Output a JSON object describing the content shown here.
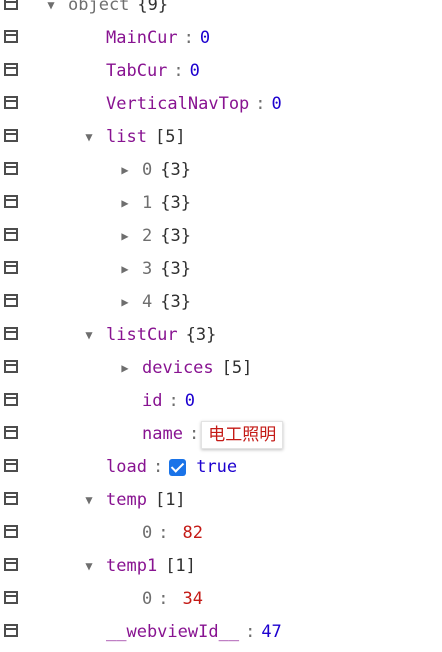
{
  "root": {
    "key": "object",
    "meta": "{9}"
  },
  "rows": {
    "main_cur": {
      "key": "MainCur",
      "value": "0"
    },
    "tab_cur": {
      "key": "TabCur",
      "value": "0"
    },
    "vertical_nav_top": {
      "key": "VerticalNavTop",
      "value": "0"
    },
    "list": {
      "key": "list",
      "meta": "[5]",
      "items": [
        {
          "key": "0",
          "meta": "{3}"
        },
        {
          "key": "1",
          "meta": "{3}"
        },
        {
          "key": "2",
          "meta": "{3}"
        },
        {
          "key": "3",
          "meta": "{3}"
        },
        {
          "key": "4",
          "meta": "{3}"
        }
      ]
    },
    "list_cur": {
      "key": "listCur",
      "meta": "{3}",
      "devices": {
        "key": "devices",
        "meta": "[5]"
      },
      "id": {
        "key": "id",
        "value": "0"
      },
      "name": {
        "key": "name",
        "value": "电工照明"
      }
    },
    "load": {
      "key": "load",
      "value": "true",
      "checked": true
    },
    "temp": {
      "key": "temp",
      "meta": "[1]",
      "item": {
        "key": "0",
        "value": "82"
      }
    },
    "temp1": {
      "key": "temp1",
      "meta": "[1]",
      "item": {
        "key": "0",
        "value": "34"
      }
    },
    "webview_id": {
      "key": "__webviewId__",
      "value": "47"
    }
  },
  "colors": {
    "key": "#881391",
    "number": "#1c00cf",
    "number_red": "#c41a16",
    "checkbox": "#1a73e8"
  },
  "icons": {
    "row_action": "edit-icon",
    "expanded": "triangle-down-icon",
    "collapsed": "triangle-right-icon"
  }
}
